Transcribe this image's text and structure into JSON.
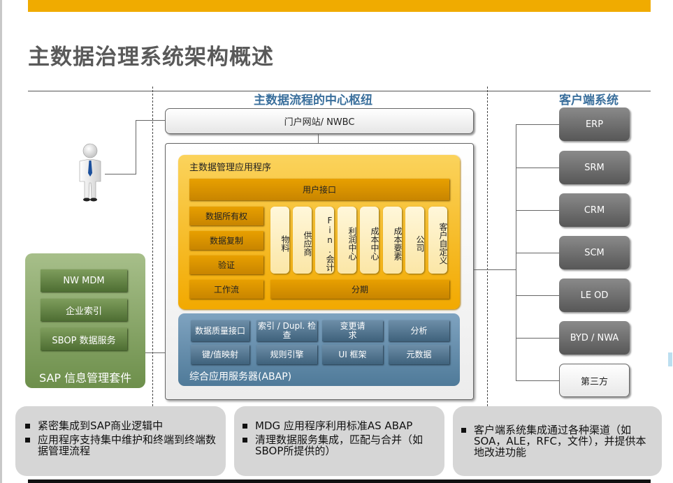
{
  "slide": {
    "title": "主数据治理系统架构概述"
  },
  "hub": {
    "section_title": "主数据流程的中心枢纽",
    "portal_label": "门户网站/ NWBC",
    "mdm_app": {
      "title": "主数据管理应用程序",
      "user_interface": "用户接口",
      "left_items": [
        "数据所有权",
        "数据复制",
        "验证",
        "工作流"
      ],
      "domains": [
        "物料",
        "供应商",
        "Fin.会计",
        "利润中心",
        "成本中心",
        "成本要素",
        "公司",
        "客户自定义"
      ],
      "staging": "分期"
    },
    "abap": {
      "label": "综合应用服务器(ABAP)",
      "row1": [
        "数据质量接口",
        "索引 / Dupl. 检查",
        "变更请求",
        "分析"
      ],
      "row2": [
        "键/值映射",
        "规则引擎",
        "UI 框架",
        "元数据"
      ]
    }
  },
  "sap_suite": {
    "label": "SAP 信息管理套件",
    "items": [
      "NW MDM",
      "企业索引",
      "SBOP 数据服务"
    ]
  },
  "clients": {
    "section_title": "客户端系统",
    "items": [
      "ERP",
      "SRM",
      "CRM",
      "SCM",
      "LE OD",
      "BYD / NWA",
      "第三方"
    ]
  },
  "bottom": {
    "panels": [
      [
        "紧密集成到SAP商业逻辑中",
        "应用程序支持集中维护和终端到终端数据管理流程"
      ],
      [
        "MDG 应用程序利用标准AS ABAP",
        "清理数据服务集成，匹配与合并（如SBOP所提供的）"
      ],
      [
        "客户端系统集成通过各种渠道（如SOA，ALE，RFC，文件），并提供本地改进功能"
      ]
    ]
  }
}
